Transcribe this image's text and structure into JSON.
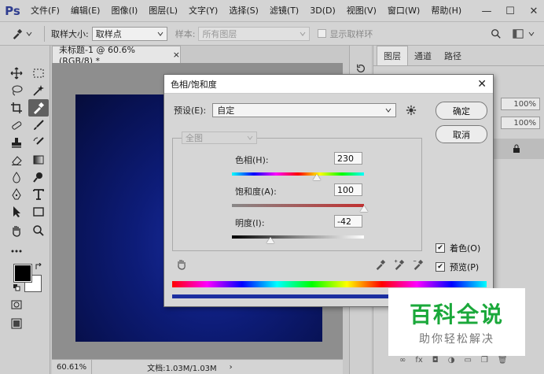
{
  "app": {
    "logo": "Ps",
    "menu": [
      "文件(F)",
      "编辑(E)",
      "图像(I)",
      "图层(L)",
      "文字(Y)",
      "选择(S)",
      "滤镜(T)",
      "3D(D)",
      "视图(V)",
      "窗口(W)",
      "帮助(H)"
    ],
    "window_controls": [
      "—",
      "☐",
      "✕"
    ]
  },
  "options_bar": {
    "sample_size_label": "取样大小:",
    "sample_size_value": "取样点",
    "sample_label": "样本:",
    "sample_value": "所有图层",
    "show_ring_label": "显示取样环"
  },
  "document": {
    "tab_title": "未标题-1 @ 60.6%(RGB/8) *",
    "tab_close": "×",
    "zoom": "60.61%",
    "doc_info": "文档:1.03M/1.03M",
    "status_arrow": "›"
  },
  "layers_panel": {
    "tabs": [
      "图层",
      "通道",
      "路径"
    ],
    "opacity": "100%",
    "fill": "100%"
  },
  "dialog": {
    "title": "色相/饱和度",
    "close": "✕",
    "preset_label": "预设(E):",
    "preset_value": "自定",
    "ok_label": "确定",
    "cancel_label": "取消",
    "channel_value": "全图",
    "hue_label": "色相(H):",
    "hue_value": "230",
    "saturation_label": "饱和度(A):",
    "saturation_value": "100",
    "lightness_label": "明度(I):",
    "lightness_value": "-42",
    "colorize_label": "着色(O)",
    "colorize_checked": true,
    "preview_label": "预览(P)",
    "preview_checked": true,
    "hue_fraction": 0.64,
    "saturation_fraction": 1.0,
    "lightness_fraction": 0.29
  },
  "watermark": {
    "main": "百科全说",
    "sub": "助你轻松解决"
  },
  "colors": {
    "foreground": "#000000",
    "background": "#ffffff",
    "watermark_green": "#1aa83a",
    "image_blue": "#0d1c78"
  }
}
